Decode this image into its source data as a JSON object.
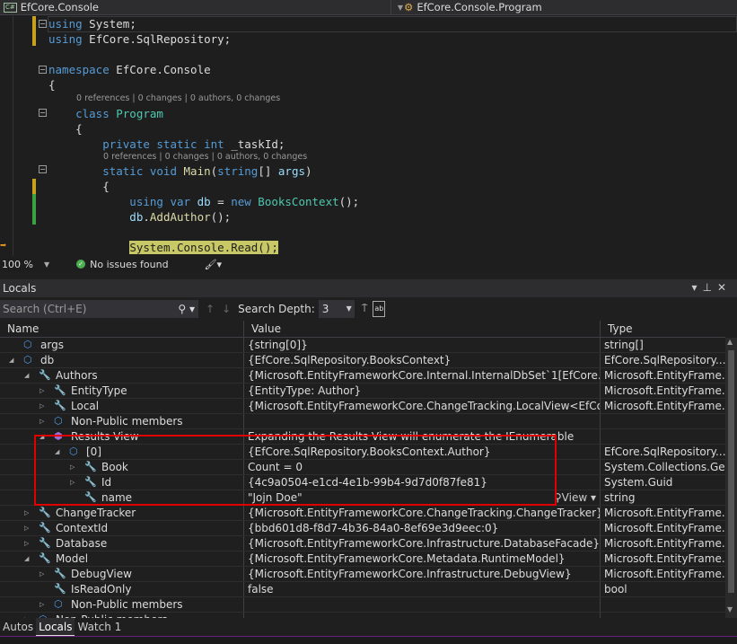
{
  "navbar": {
    "project": "EfCore.Console",
    "member": "EfCore.Console.Program"
  },
  "editor": {
    "lines": [
      [
        {
          "t": "using",
          "c": "kw"
        },
        {
          "t": " System;",
          "c": "pl"
        }
      ],
      [
        {
          "t": "using",
          "c": "kw"
        },
        {
          "t": " EfCore.SqlRepository;",
          "c": "pl"
        }
      ],
      [
        {
          "t": "namespace",
          "c": "kw"
        },
        {
          "t": " EfCore.Console",
          "c": "pl"
        }
      ],
      [
        {
          "t": "{",
          "c": "pl"
        }
      ],
      [
        {
          "t": "    class",
          "c": "kw"
        },
        {
          "t": " Program",
          "c": "ty"
        }
      ],
      [
        {
          "t": "    {",
          "c": "pl"
        }
      ],
      [
        {
          "t": "        private static int",
          "c": "kw"
        },
        {
          "t": " _taskId;",
          "c": "pl"
        }
      ],
      [
        {
          "t": "        static void",
          "c": "kw"
        },
        {
          "t": " Main",
          "c": "fn"
        },
        {
          "t": "(",
          "c": "pl"
        },
        {
          "t": "string",
          "c": "kw"
        },
        {
          "t": "[] ",
          "c": "pl"
        },
        {
          "t": "args",
          "c": "id"
        },
        {
          "t": ")",
          "c": "pl"
        }
      ],
      [
        {
          "t": "        {",
          "c": "pl"
        }
      ],
      [
        {
          "t": "            using var",
          "c": "kw"
        },
        {
          "t": " db",
          "c": "id"
        },
        {
          "t": " = ",
          "c": "pl"
        },
        {
          "t": "new",
          "c": "kw"
        },
        {
          "t": " BooksContext",
          "c": "ty"
        },
        {
          "t": "();",
          "c": "pl"
        }
      ],
      [
        {
          "t": "            db",
          "c": "id"
        },
        {
          "t": ".",
          "c": "pl"
        },
        {
          "t": "AddAuthor",
          "c": "fn"
        },
        {
          "t": "();",
          "c": "pl"
        }
      ],
      [
        {
          "t": "            ",
          "c": "pl"
        },
        {
          "t": "System.Console.Read();",
          "c": "hl"
        }
      ]
    ],
    "codelens": "0 references | 0 changes | 0 authors, 0 changes"
  },
  "status": {
    "zoom": "100 %",
    "issues": "No issues found"
  },
  "locals": {
    "title": "Locals",
    "search_placeholder": "Search (Ctrl+E)",
    "search_depth_label": "Search Depth:",
    "search_depth": "3",
    "columns": [
      "Name",
      "Value",
      "Type"
    ],
    "rows": [
      {
        "level": 0,
        "exp": "",
        "icon": "object-icon",
        "name": "args",
        "value": "{string[0]}",
        "type": "string[]"
      },
      {
        "level": 0,
        "exp": "expanded",
        "icon": "object-icon",
        "name": "db",
        "value": "{EfCore.SqlRepository.BooksContext}",
        "type": "EfCore.SqlRepository...."
      },
      {
        "level": 1,
        "exp": "expanded",
        "icon": "property-icon",
        "name": "Authors",
        "value": "{Microsoft.EntityFrameworkCore.Internal.InternalDbSet`1[EfCore.SqlRepo...",
        "type": "Microsoft.EntityFrame..."
      },
      {
        "level": 2,
        "exp": "collapsed",
        "icon": "property-icon",
        "name": "EntityType",
        "value": "{EntityType: Author}",
        "type": "Microsoft.EntityFrame..."
      },
      {
        "level": 2,
        "exp": "collapsed",
        "icon": "property-icon",
        "name": "Local",
        "value": "{Microsoft.EntityFrameworkCore.ChangeTracking.LocalView<EfCore.Sql...",
        "type": "Microsoft.EntityFrame..."
      },
      {
        "level": 2,
        "exp": "collapsed",
        "icon": "object-icon",
        "name": "Non-Public members",
        "value": "",
        "type": ""
      },
      {
        "level": 2,
        "exp": "expanded",
        "icon": "results-view-icon",
        "name": "Results View",
        "value": "Expanding the Results View will enumerate the IEnumerable",
        "type": ""
      },
      {
        "level": 3,
        "exp": "expanded",
        "icon": "object-icon",
        "name": "[0]",
        "value": "{EfCore.SqlRepository.BooksContext.Author}",
        "type": "EfCore.SqlRepository...."
      },
      {
        "level": 4,
        "exp": "collapsed",
        "icon": "property-icon",
        "name": "Book",
        "value": "Count = 0",
        "type": "System.Collections.Ge..."
      },
      {
        "level": 4,
        "exp": "collapsed",
        "icon": "property-icon",
        "name": "Id",
        "value": "{4c9a0504-e1cd-4e1b-99b4-9d7d0f87fe81}",
        "type": "System.Guid"
      },
      {
        "level": 4,
        "exp": "",
        "icon": "property-icon",
        "name": "name",
        "value": "\"Jojn Doe\"",
        "type": "string",
        "view": "View"
      },
      {
        "level": 1,
        "exp": "collapsed",
        "icon": "property-icon",
        "name": "ChangeTracker",
        "value": "{Microsoft.EntityFrameworkCore.ChangeTracking.ChangeTracker}",
        "type": "Microsoft.EntityFrame..."
      },
      {
        "level": 1,
        "exp": "collapsed",
        "icon": "property-icon",
        "name": "ContextId",
        "value": "{bbd601d8-f8d7-4b36-84a0-8ef69e3d9eec:0}",
        "type": "Microsoft.EntityFrame..."
      },
      {
        "level": 1,
        "exp": "collapsed",
        "icon": "property-icon",
        "name": "Database",
        "value": "{Microsoft.EntityFrameworkCore.Infrastructure.DatabaseFacade}",
        "type": "Microsoft.EntityFrame..."
      },
      {
        "level": 1,
        "exp": "expanded",
        "icon": "property-icon",
        "name": "Model",
        "value": "{Microsoft.EntityFrameworkCore.Metadata.RuntimeModel}",
        "type": "Microsoft.EntityFrame..."
      },
      {
        "level": 2,
        "exp": "collapsed",
        "icon": "property-icon",
        "name": "DebugView",
        "value": "{Microsoft.EntityFrameworkCore.Infrastructure.DebugView}",
        "type": "Microsoft.EntityFrame..."
      },
      {
        "level": 2,
        "exp": "",
        "icon": "property-icon",
        "name": "IsReadOnly",
        "value": "false",
        "type": "bool"
      },
      {
        "level": 2,
        "exp": "collapsed",
        "icon": "object-icon",
        "name": "Non-Public members",
        "value": "",
        "type": ""
      },
      {
        "level": 1,
        "exp": "collapsed",
        "icon": "object-icon",
        "name": "Non-Public members",
        "value": "",
        "type": ""
      }
    ]
  },
  "tabs": [
    {
      "label": "Autos",
      "active": false
    },
    {
      "label": "Locals",
      "active": true
    },
    {
      "label": "Watch 1",
      "active": false
    }
  ],
  "colors": {
    "highlight_box": "#e00000",
    "accent": "#68217a"
  }
}
